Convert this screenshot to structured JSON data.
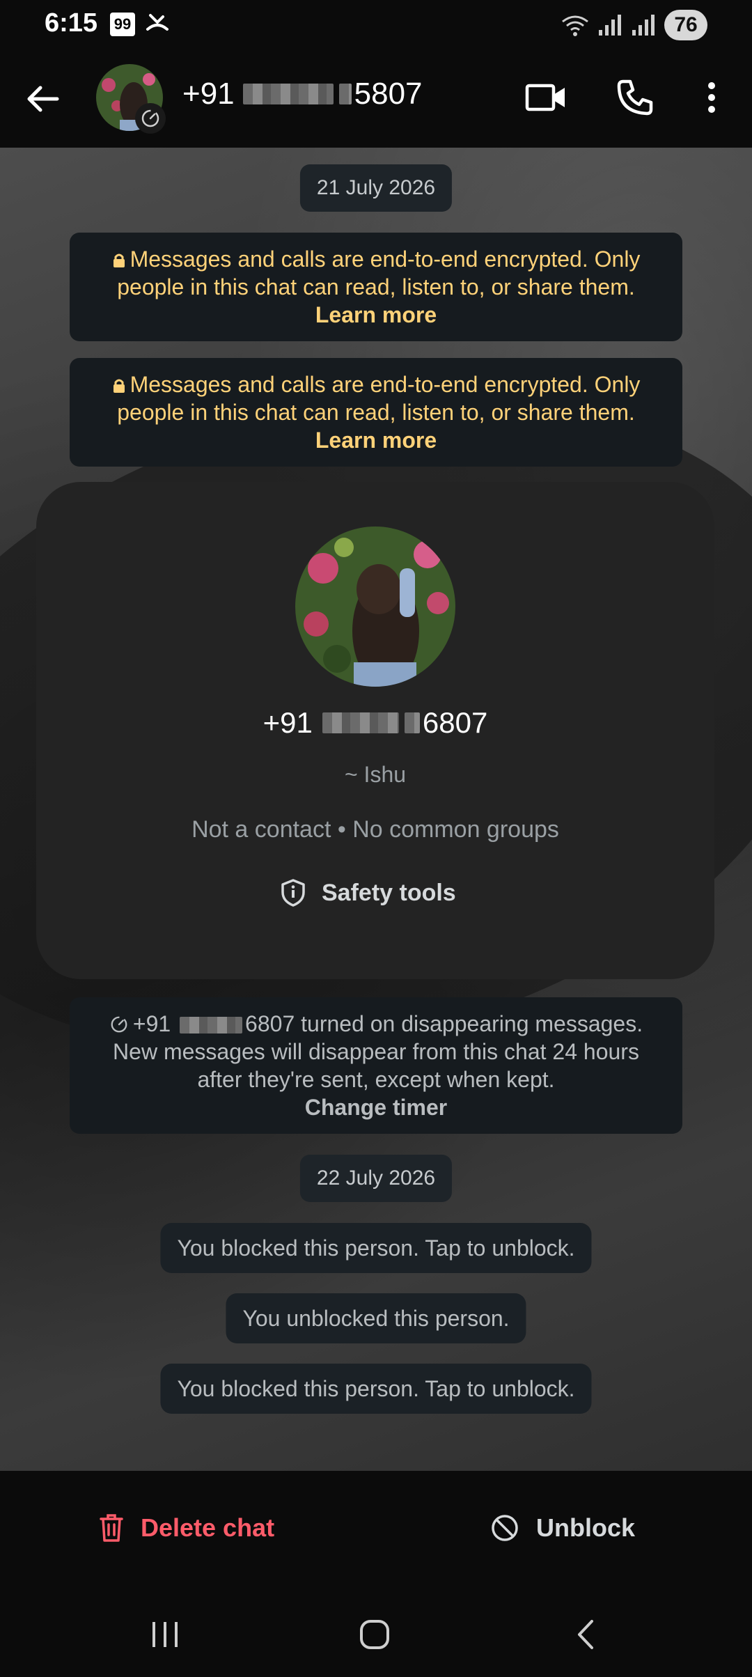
{
  "status_bar": {
    "time": "6:15",
    "notif_badge": "99",
    "battery": "76",
    "network_tag": "5"
  },
  "header": {
    "phone_prefix": "+91",
    "phone_suffix": "5807"
  },
  "chat": {
    "date_1": "21 July 2026",
    "encryption_notices": [
      {
        "text": "Messages and calls are end-to-end encrypted. Only people in this chat can read, listen to, or share them.",
        "link": "Learn more"
      },
      {
        "text": "Messages and calls are end-to-end encrypted. Only people in this chat can read, listen to, or share them.",
        "link": "Learn more"
      }
    ],
    "profile_card": {
      "phone_prefix": "+91",
      "phone_suffix": "6807",
      "name": "~ Ishu",
      "meta": "Not a contact • No common groups",
      "safety_tools": "Safety tools"
    },
    "disappearing_notice": {
      "phone_prefix": "+91",
      "phone_suffix": "6807",
      "text": "turned on disappearing messages. New messages will disappear from this chat 24 hours after they're sent, except when kept.",
      "link": "Change timer"
    },
    "date_2": "22 July 2026",
    "events": [
      "You blocked this person. Tap to unblock.",
      "You unblocked this person.",
      "You blocked this person. Tap to unblock."
    ]
  },
  "actions": {
    "delete_chat": "Delete chat",
    "unblock": "Unblock"
  },
  "colors": {
    "accent_yellow": "#ffd279",
    "danger_red": "#ff5c6a"
  }
}
